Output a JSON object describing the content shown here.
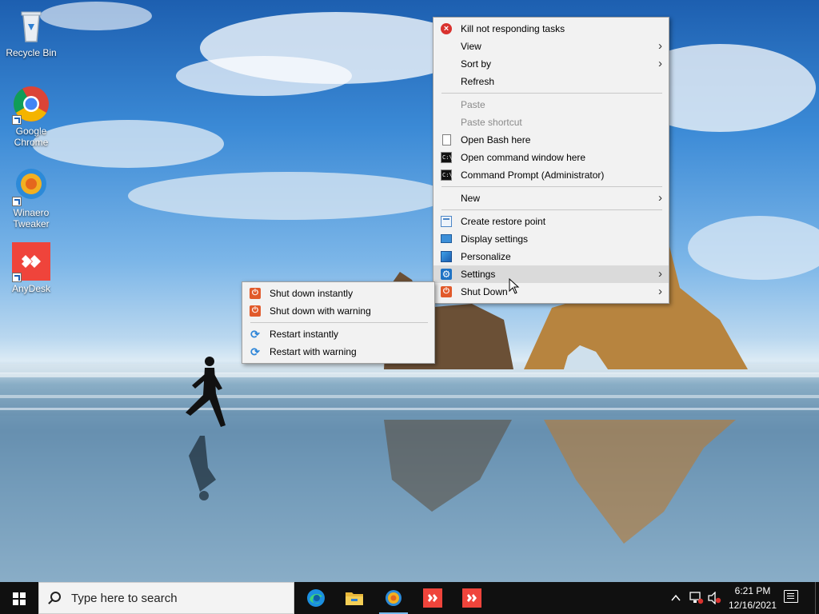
{
  "desktop": {
    "icons": [
      {
        "label": "Recycle Bin",
        "icon": "recycle-bin-icon"
      },
      {
        "label": "Google Chrome",
        "icon": "chrome-icon"
      },
      {
        "label": "Winaero Tweaker",
        "icon": "winaero-tweaker-icon"
      },
      {
        "label": "AnyDesk",
        "icon": "anydesk-icon"
      }
    ]
  },
  "context_menu": {
    "items": [
      {
        "label": "Kill not responding tasks",
        "icon": "kill-tasks-icon"
      },
      {
        "label": "View",
        "submenu": true
      },
      {
        "label": "Sort by",
        "submenu": true
      },
      {
        "label": "Refresh"
      },
      {
        "label": "Paste",
        "disabled": true
      },
      {
        "label": "Paste shortcut",
        "disabled": true
      },
      {
        "label": "Open Bash here",
        "icon": "bash-page-icon"
      },
      {
        "label": "Open command window here",
        "icon": "cmd-icon"
      },
      {
        "label": "Command Prompt (Administrator)",
        "icon": "cmd-admin-icon"
      },
      {
        "label": "New",
        "submenu": true
      },
      {
        "label": "Create restore point",
        "icon": "restore-point-icon"
      },
      {
        "label": "Display settings",
        "icon": "display-icon"
      },
      {
        "label": "Personalize",
        "icon": "personalize-icon"
      },
      {
        "label": "Settings",
        "icon": "settings-gear-icon",
        "submenu": true,
        "highlighted": true
      },
      {
        "label": "Shut Down",
        "icon": "shutdown-icon",
        "submenu": true
      }
    ]
  },
  "shutdown_submenu": {
    "items": [
      {
        "label": "Shut down instantly",
        "icon": "power-icon"
      },
      {
        "label": "Shut down with warning",
        "icon": "power-icon"
      },
      {
        "label": "Restart instantly",
        "icon": "restart-icon"
      },
      {
        "label": "Restart with warning",
        "icon": "restart-icon"
      }
    ]
  },
  "taskbar": {
    "search_placeholder": "Type here to search",
    "apps": [
      "edge-icon",
      "file-explorer-icon",
      "winaero-tweaker-icon",
      "anydesk-icon",
      "anydesk-icon"
    ],
    "clock": {
      "time": "6:21 PM",
      "date": "12/16/2021"
    },
    "colors": {
      "taskbar_bg": "#101010",
      "active_indicator": "#76b9ed",
      "menu_bg": "#f2f2f2",
      "anydesk_red": "#ef443b"
    }
  }
}
